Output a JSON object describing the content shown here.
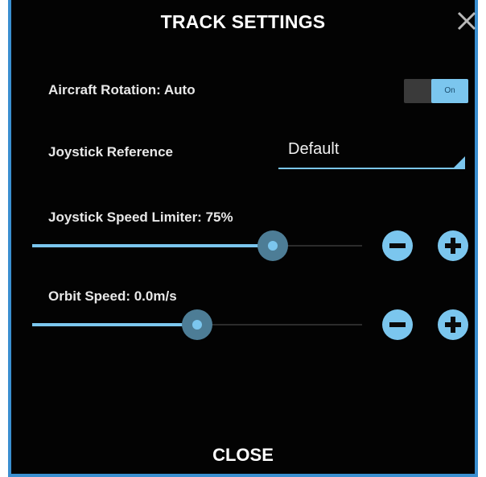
{
  "dialog": {
    "title": "TRACK SETTINGS",
    "close_label": "CLOSE",
    "close_icon": "close-icon"
  },
  "settings": {
    "aircraft_rotation": {
      "label": "Aircraft Rotation: Auto",
      "toggle_state": "On",
      "toggle_on": true
    },
    "joystick_reference": {
      "label": "Joystick Reference",
      "selected": "Default"
    },
    "speed_limiter": {
      "label": "Joystick Speed Limiter: 75%",
      "value_fraction": 0.73
    },
    "orbit_speed": {
      "label": "Orbit Speed: 0.0m/s",
      "value_fraction": 0.5
    }
  },
  "colors": {
    "accent": "#7bc6ee",
    "frame": "#3a8fd0",
    "background": "#030303"
  }
}
